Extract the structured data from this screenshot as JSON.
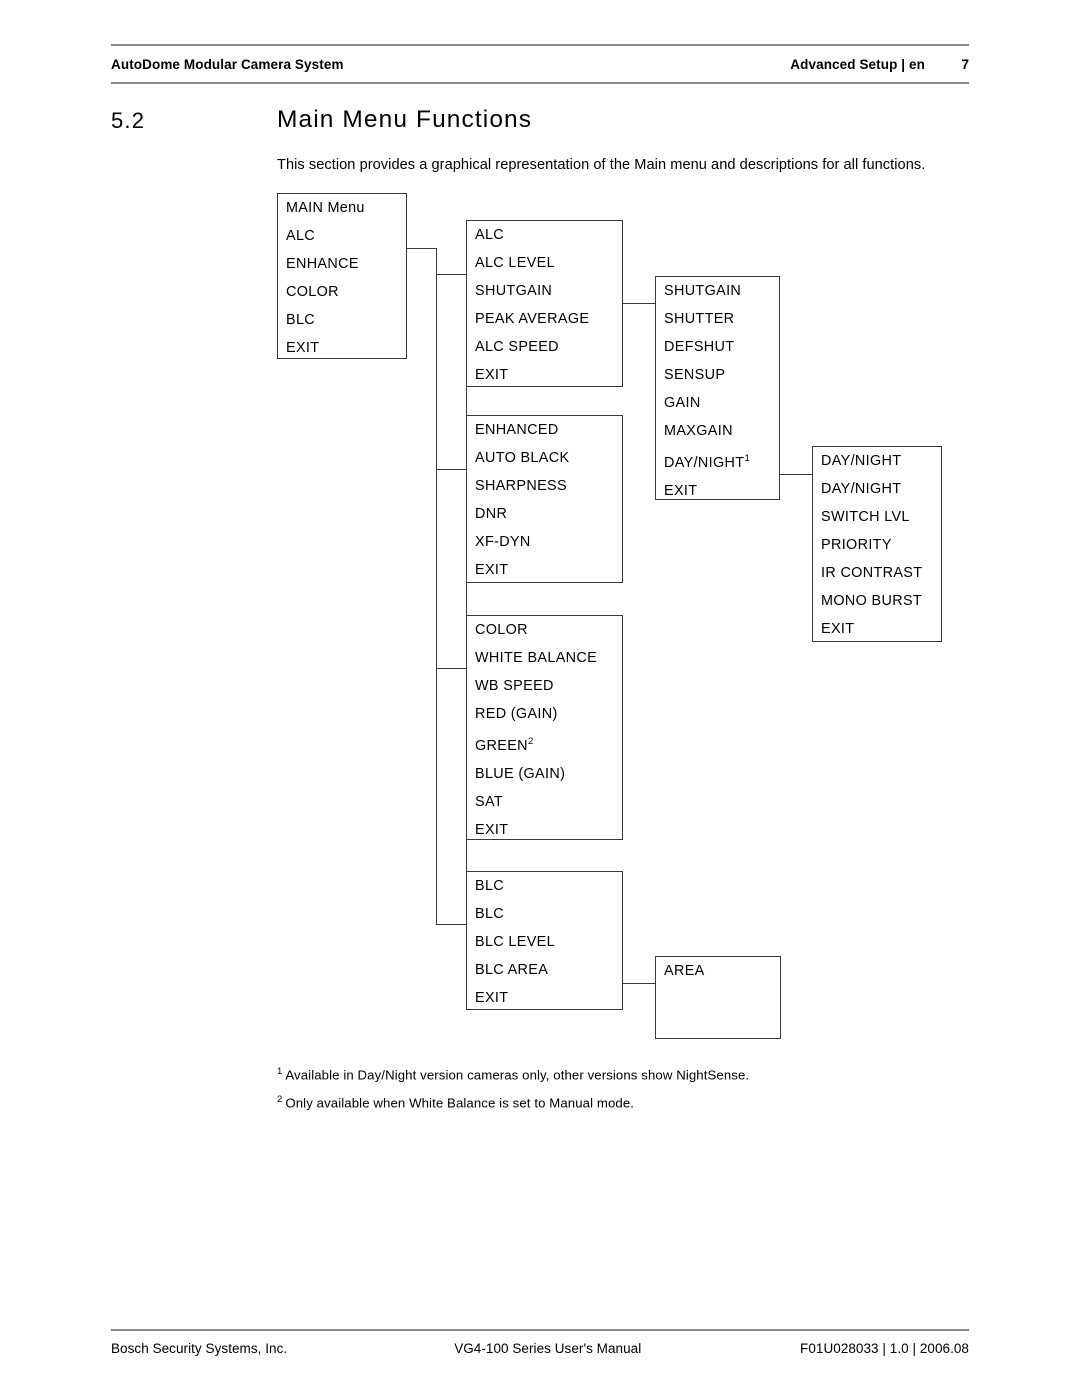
{
  "header": {
    "left": "AutoDome Modular Camera System",
    "right": "Advanced Setup | en",
    "page_number": "7"
  },
  "section": {
    "number": "5.2",
    "title": "Main Menu Functions"
  },
  "intro": "This section provides a graphical representation of the Main menu and descriptions for all functions.",
  "diagram": {
    "boxes": {
      "main_menu": {
        "title": "MAIN Menu",
        "items": [
          "ALC",
          "ENHANCE",
          "COLOR",
          "BLC",
          "EXIT"
        ]
      },
      "alc": {
        "title": "ALC",
        "items": [
          "ALC LEVEL",
          "SHUTGAIN",
          "PEAK AVERAGE",
          "ALC SPEED",
          "EXIT"
        ]
      },
      "shutgain": {
        "title": "SHUTGAIN",
        "items": [
          "SHUTTER",
          "DEFSHUT",
          "SENSUP",
          "GAIN",
          "MAXGAIN",
          "DAY/NIGHT",
          "EXIT"
        ],
        "daynight_footnote_marker": "1"
      },
      "daynight": {
        "title": "DAY/NIGHT",
        "items": [
          "DAY/NIGHT",
          "SWITCH LVL",
          "PRIORITY",
          "IR CONTRAST",
          "MONO BURST",
          "EXIT"
        ]
      },
      "enhanced": {
        "title": "ENHANCED",
        "items": [
          "AUTO BLACK",
          "SHARPNESS",
          "DNR",
          "XF-DYN",
          "EXIT"
        ]
      },
      "color": {
        "title": "COLOR",
        "items": [
          "WHITE BALANCE",
          "WB SPEED",
          "RED (GAIN)",
          "GREEN",
          "BLUE (GAIN)",
          "SAT",
          "EXIT"
        ],
        "green_footnote_marker": "2"
      },
      "blc": {
        "title": "BLC",
        "items": [
          "BLC",
          "BLC LEVEL",
          "BLC AREA",
          "EXIT"
        ]
      },
      "area": {
        "title": "AREA",
        "items": []
      }
    }
  },
  "footnotes": [
    {
      "marker": "1",
      "text": "Available in Day/Night version cameras only, other versions show NightSense."
    },
    {
      "marker": "2",
      "text": "Only available when White Balance is set to Manual mode."
    }
  ],
  "footer": {
    "left": "Bosch Security Systems, Inc.",
    "center": "VG4-100 Series User's Manual",
    "right": "F01U028033 | 1.0 | 2006.08"
  }
}
